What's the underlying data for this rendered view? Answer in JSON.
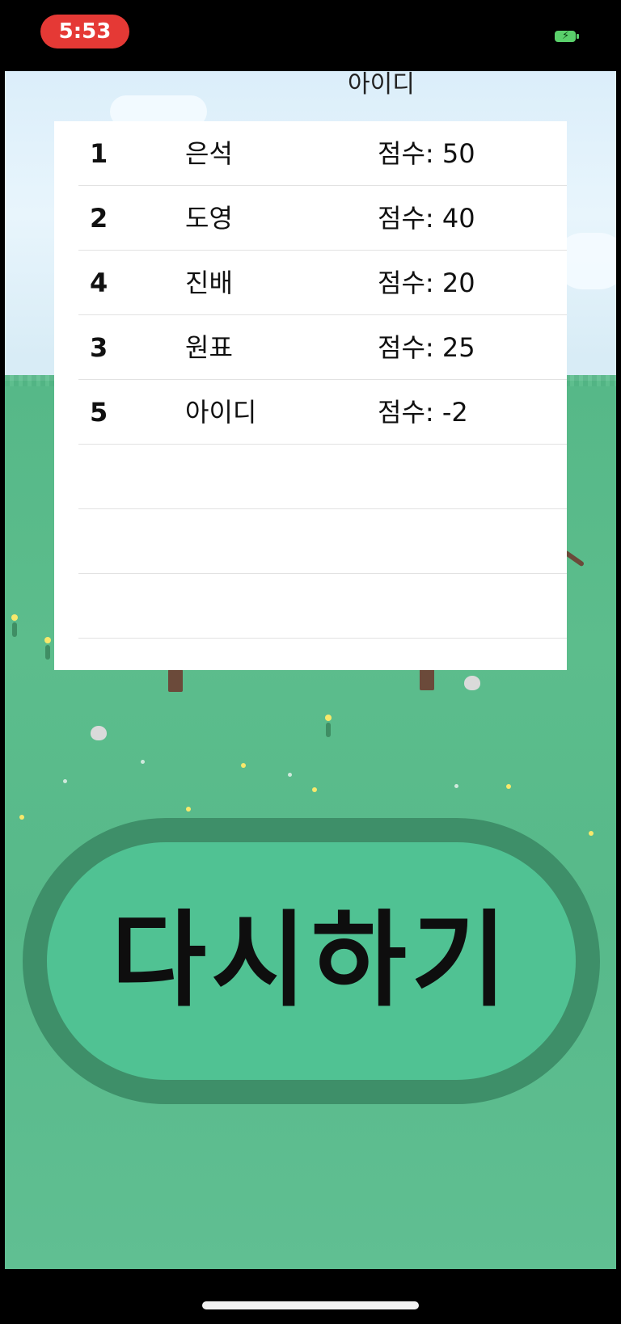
{
  "status_bar": {
    "time": "5:53",
    "time_pill_color": "#e53935",
    "battery_icon": "battery-charging-icon",
    "battery_color": "#5ad06b"
  },
  "scoreboard": {
    "header": "아이디",
    "score_prefix": "점수: ",
    "rows": [
      {
        "rank": "1",
        "name": "은석",
        "score": "점수: 50"
      },
      {
        "rank": "2",
        "name": "도영",
        "score": "점수: 40"
      },
      {
        "rank": "4",
        "name": "진배",
        "score": "점수: 20"
      },
      {
        "rank": "3",
        "name": "원표",
        "score": "점수: 25"
      },
      {
        "rank": "5",
        "name": "아이디",
        "score": "점수: -2"
      },
      {
        "rank": "",
        "name": "",
        "score": ""
      },
      {
        "rank": "",
        "name": "",
        "score": ""
      },
      {
        "rank": "",
        "name": "",
        "score": ""
      }
    ]
  },
  "retry": {
    "label": "다시하기"
  },
  "colors": {
    "grass": "#56b888",
    "button_fill": "#50c293",
    "button_border": "#3e8f69"
  }
}
